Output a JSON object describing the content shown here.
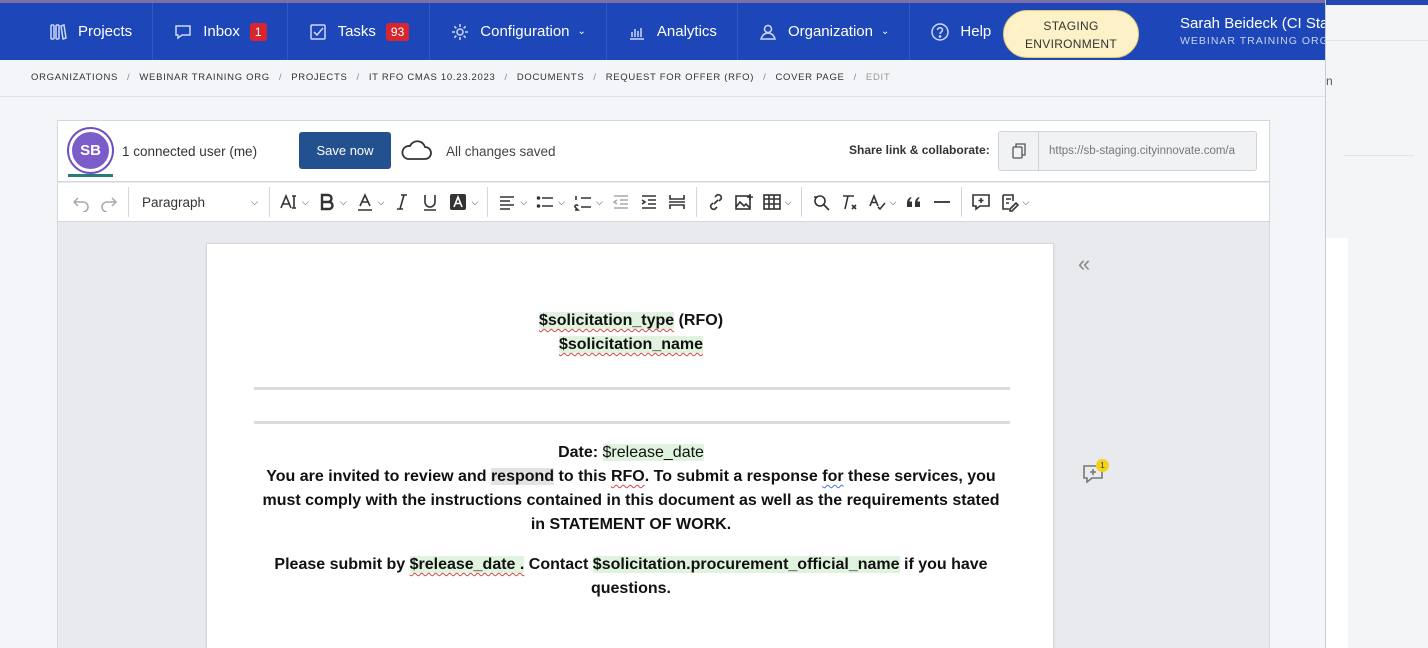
{
  "nav": {
    "items": [
      {
        "label": "Projects",
        "icon": "projects-icon"
      },
      {
        "label": "Inbox",
        "icon": "inbox-icon",
        "badge": "1"
      },
      {
        "label": "Tasks",
        "icon": "tasks-icon",
        "badge": "93"
      },
      {
        "label": "Configuration",
        "icon": "gear-icon",
        "dropdown": true
      },
      {
        "label": "Analytics",
        "icon": "analytics-icon"
      },
      {
        "label": "Organization",
        "icon": "organization-icon",
        "dropdown": true
      },
      {
        "label": "Help",
        "icon": "help-icon"
      }
    ],
    "staging_line1": "STAGING",
    "staging_line2": "ENVIRONMENT",
    "user_name": "Sarah Beideck (CI Sta",
    "user_org": "WEBINAR TRAINING ORG"
  },
  "breadcrumb": [
    "ORGANIZATIONS",
    "WEBINAR TRAINING ORG",
    "PROJECTS",
    "IT RFO CMAS 10.23.2023",
    "DOCUMENTS",
    "REQUEST FOR OFFER (RFO)",
    "COVER PAGE",
    "EDIT"
  ],
  "collab": {
    "avatar_initials": "SB",
    "connected_users": "1 connected user (me)",
    "save_label": "Save now",
    "save_status": "All changes saved",
    "share_label": "Share link & collaborate:",
    "share_url": "https://sb-staging.cityinnovate.com/a"
  },
  "toolbar": {
    "paragraph_style": "Paragraph"
  },
  "document": {
    "line1_var": "$solicitation_type",
    "line1_rest": " (RFO)",
    "line2_var": "$solicitation_name",
    "date_label": "Date: ",
    "date_var": "$release_date",
    "para1_a": "You are invited to review and ",
    "para1_hl": "respond",
    "para1_b": " to this ",
    "para1_rfo": "RFO",
    "para1_c": ".  To submit a response ",
    "para1_for": "for",
    "para1_d": " these services, you must comply with the instructions contained in this document as well as the requirements stated in STATEMENT OF WORK.",
    "para2_a": "Please submit by ",
    "para2_var1": "$release_date .",
    "para2_b": " Contact ",
    "para2_var2": "$solicitation.procurement_official_name",
    "para2_c": " if you have questions."
  },
  "sidebar": {
    "collapse_glyph": "«",
    "comment_count": "1"
  },
  "colors": {
    "nav_bg": "#1d46b8",
    "badge": "#d8262f",
    "save_button": "#23508f",
    "staging_bg": "#fdf1c7",
    "variable_highlight": "#dff3de",
    "avatar": "#7b5cc9"
  }
}
